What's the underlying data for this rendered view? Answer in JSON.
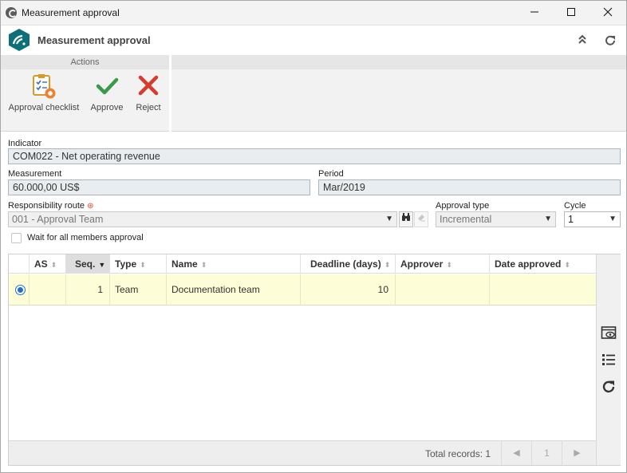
{
  "window": {
    "title": "Measurement approval",
    "controls": {
      "minimize": "—",
      "maximize": "☐",
      "close": "✕"
    }
  },
  "header": {
    "title": "Measurement approval",
    "collapse_icon": "chevrons-up-icon",
    "refresh_icon": "refresh-icon"
  },
  "ribbon": {
    "group_label": "Actions",
    "buttons": [
      {
        "label": "Approval checklist",
        "icon": "checklist-icon"
      },
      {
        "label": "Approve",
        "icon": "checkmark-icon"
      },
      {
        "label": "Reject",
        "icon": "x-icon"
      }
    ]
  },
  "form": {
    "indicator": {
      "label": "Indicator",
      "value": "COM022 - Net operating revenue"
    },
    "measurement": {
      "label": "Measurement",
      "value": "60.000,00 US$"
    },
    "period": {
      "label": "Period",
      "value": "Mar/2019"
    },
    "responsibility_route": {
      "label": "Responsibility route",
      "value": "001 - Approval Team",
      "required": true
    },
    "approval_type": {
      "label": "Approval type",
      "value": "Incremental"
    },
    "cycle": {
      "label": "Cycle",
      "value": "1"
    },
    "wait_all": {
      "label": "Wait for all members approval",
      "checked": false
    }
  },
  "grid": {
    "columns": [
      "AS",
      "Seq.",
      "Type",
      "Name",
      "Deadline (days)",
      "Approver",
      "Date approved"
    ],
    "rows": [
      {
        "selected": true,
        "as": "",
        "seq": "1",
        "type": "Team",
        "name": "Documentation team",
        "deadline": "10",
        "approver": "",
        "date_approved": ""
      }
    ],
    "footer": {
      "total_label": "Total records: 1",
      "page": "1"
    },
    "side_icons": [
      "view-icon",
      "list-icon",
      "refresh-icon"
    ]
  },
  "colors": {
    "accent": "#1f6fd1",
    "selected_row": "#fdfdd8",
    "approve_green": "#3a9a4a",
    "reject_red": "#d83a2e",
    "logo_teal": "#0d6f78"
  }
}
